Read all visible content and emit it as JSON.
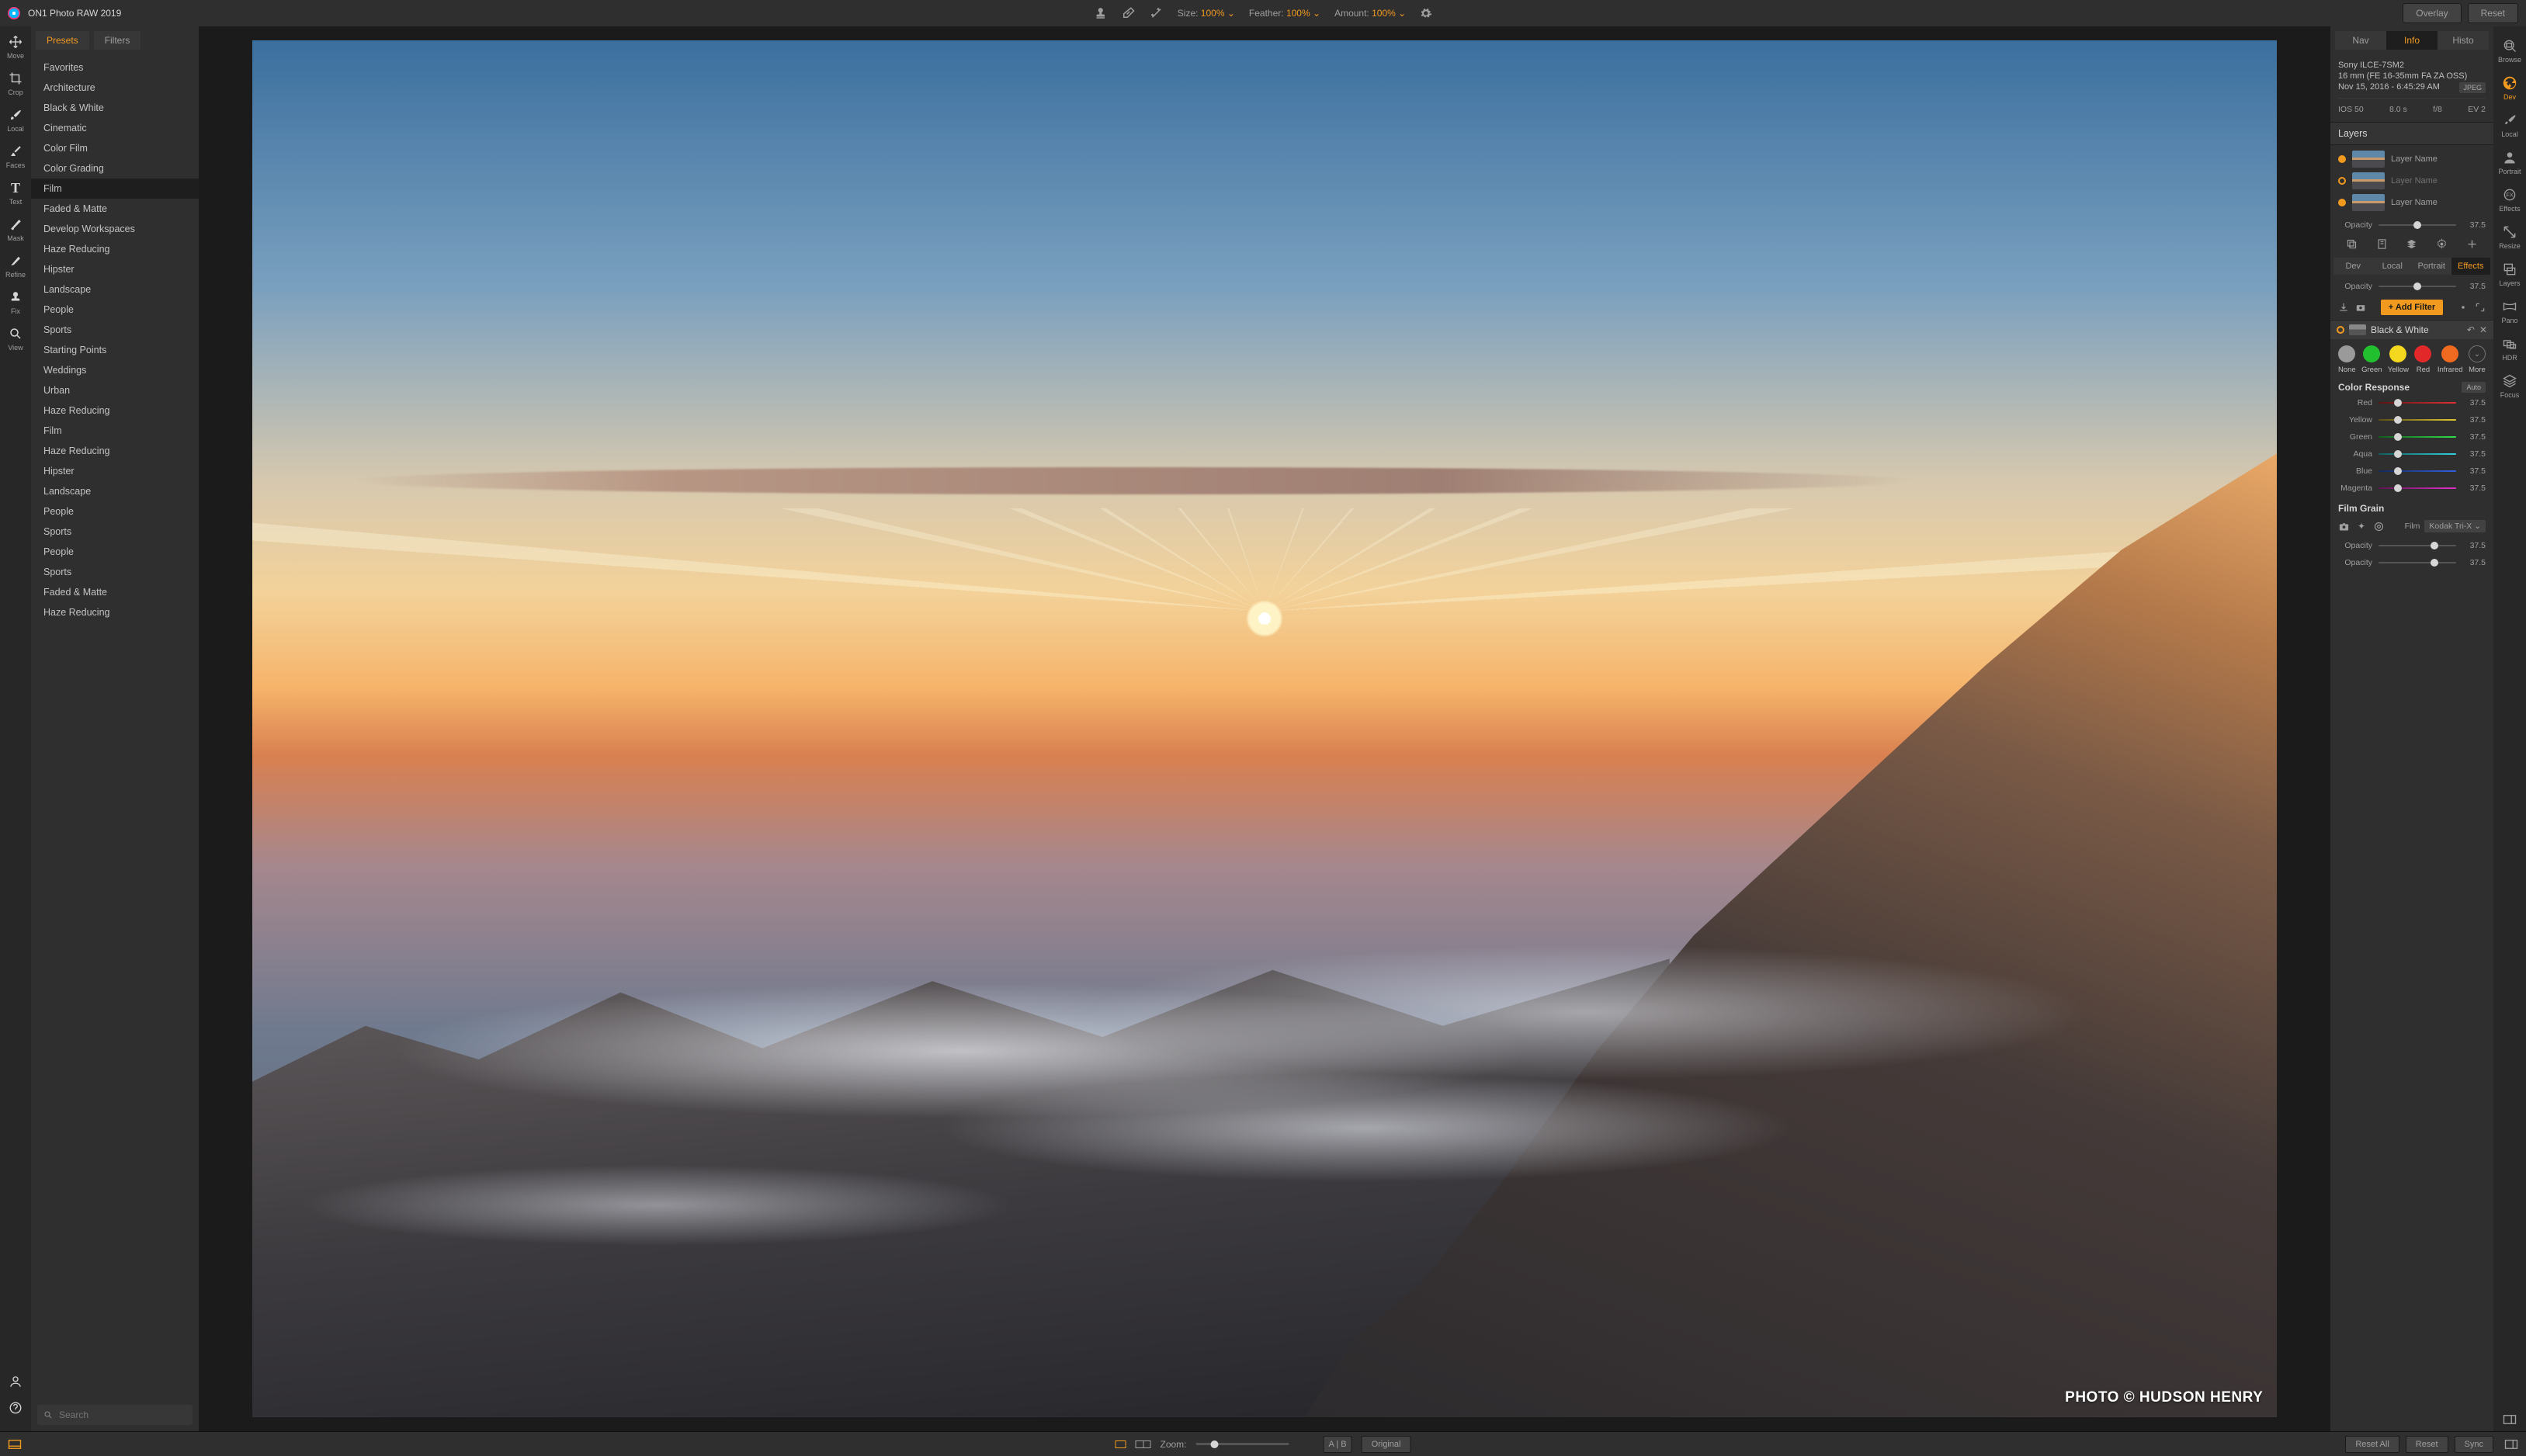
{
  "app": {
    "title": "ON1 Photo RAW 2019"
  },
  "titlebar": {
    "size_label": "Size:",
    "size_value": "100%",
    "feather_label": "Feather:",
    "feather_value": "100%",
    "amount_label": "Amount:",
    "amount_value": "100%",
    "overlay_btn": "Overlay",
    "reset_btn": "Reset"
  },
  "left_tools": [
    {
      "id": "move",
      "label": "Move"
    },
    {
      "id": "crop",
      "label": "Crop"
    },
    {
      "id": "local",
      "label": "Local"
    },
    {
      "id": "faces",
      "label": "Faces"
    },
    {
      "id": "text",
      "label": "Text"
    },
    {
      "id": "mask",
      "label": "Mask"
    },
    {
      "id": "refine",
      "label": "Refine"
    },
    {
      "id": "fix",
      "label": "Fix"
    },
    {
      "id": "view",
      "label": "View"
    }
  ],
  "presets": {
    "tabs": {
      "presets": "Presets",
      "filters": "Filters"
    },
    "items": [
      "Favorites",
      "Architecture",
      "Black & White",
      "Cinematic",
      "Color Film",
      "Color Grading",
      "Film",
      "Faded & Matte",
      "Develop Workspaces",
      "Haze Reducing",
      "Hipster",
      "Landscape",
      "People",
      "Sports",
      "Starting Points",
      "Weddings",
      "Urban",
      "Haze Reducing",
      "Film",
      "Haze Reducing",
      "Hipster",
      "Landscape",
      "People",
      "Sports",
      "People",
      "Sports",
      "Faded & Matte",
      "Haze Reducing"
    ],
    "selected_index": 6,
    "search_placeholder": "Search"
  },
  "canvas": {
    "watermark": "PHOTO © HUDSON HENRY"
  },
  "info_panel": {
    "tabs": {
      "nav": "Nav",
      "info": "Info",
      "histo": "Histo"
    },
    "camera": "Sony ILCE-7SM2",
    "lens": "16 mm (FE 16-35mm FA ZA OSS)",
    "datetime": "Nov 15, 2016 - 6:45:29 AM",
    "format": "JPEG",
    "iso": "IOS 50",
    "shutter": "8.0 s",
    "aperture": "f/8",
    "ev": "EV 2"
  },
  "layers": {
    "title": "Layers",
    "rows": [
      {
        "name": "Layer Name",
        "visible": true
      },
      {
        "name": "Layer Name",
        "visible": false,
        "dim": true
      },
      {
        "name": "Layer Name",
        "visible": true
      }
    ],
    "opacity_label": "Opacity",
    "opacity_value": "37.5"
  },
  "edit_tabs": {
    "dev": "Dev",
    "local": "Local",
    "portrait": "Portrait",
    "effects": "Effects"
  },
  "effects": {
    "opacity_label": "Opacity",
    "opacity_value": "37.5",
    "add_filter": "+ Add Filter",
    "filter_name": "Black & White",
    "swatches": [
      {
        "label": "None",
        "color": "#9a9a9a"
      },
      {
        "label": "Green",
        "color": "#22c02e"
      },
      {
        "label": "Yellow",
        "color": "#f4d71f"
      },
      {
        "label": "Red",
        "color": "#e22828"
      },
      {
        "label": "Infrared",
        "color": "#f06a1f"
      },
      {
        "label": "More",
        "color": "",
        "more": true
      }
    ],
    "cr_title": "Color Response",
    "cr_badge": "Auto",
    "channels": [
      {
        "name": "Red",
        "value": "37.5",
        "grad": "linear-gradient(to right,#5c1414,#e03030)"
      },
      {
        "name": "Yellow",
        "value": "37.5",
        "grad": "linear-gradient(to right,#5c5014,#e0c830)"
      },
      {
        "name": "Green",
        "value": "37.5",
        "grad": "linear-gradient(to right,#145c1e,#30e04a)"
      },
      {
        "name": "Aqua",
        "value": "37.5",
        "grad": "linear-gradient(to right,#145c5c,#30d0e0)"
      },
      {
        "name": "Blue",
        "value": "37.5",
        "grad": "linear-gradient(to right,#142a5c,#3060e0)"
      },
      {
        "name": "Magenta",
        "value": "37.5",
        "grad": "linear-gradient(to right,#5c1452,#e030c8)"
      }
    ],
    "grain_title": "Film Grain",
    "film_label": "Film",
    "film_value": "Kodak Tri-X",
    "grain_op1": "Opacity",
    "grain_v1": "37.5",
    "grain_op2": "Opacity",
    "grain_v2": "37.5"
  },
  "right_tools": [
    {
      "id": "browse",
      "label": "Browse"
    },
    {
      "id": "dev",
      "label": "Dev",
      "active": true
    },
    {
      "id": "local",
      "label": "Local"
    },
    {
      "id": "portrait",
      "label": "Portrait"
    },
    {
      "id": "effects",
      "label": "Effects"
    },
    {
      "id": "resize",
      "label": "Resize"
    },
    {
      "id": "layers",
      "label": "Layers"
    },
    {
      "id": "pano",
      "label": "Pano"
    },
    {
      "id": "hdr",
      "label": "HDR"
    },
    {
      "id": "focus",
      "label": "Focus"
    }
  ],
  "bottombar": {
    "zoom_label": "Zoom:",
    "ab_a": "A",
    "ab_b": "B",
    "original": "Original",
    "reset_all": "Reset All",
    "reset": "Reset",
    "sync": "Sync"
  }
}
